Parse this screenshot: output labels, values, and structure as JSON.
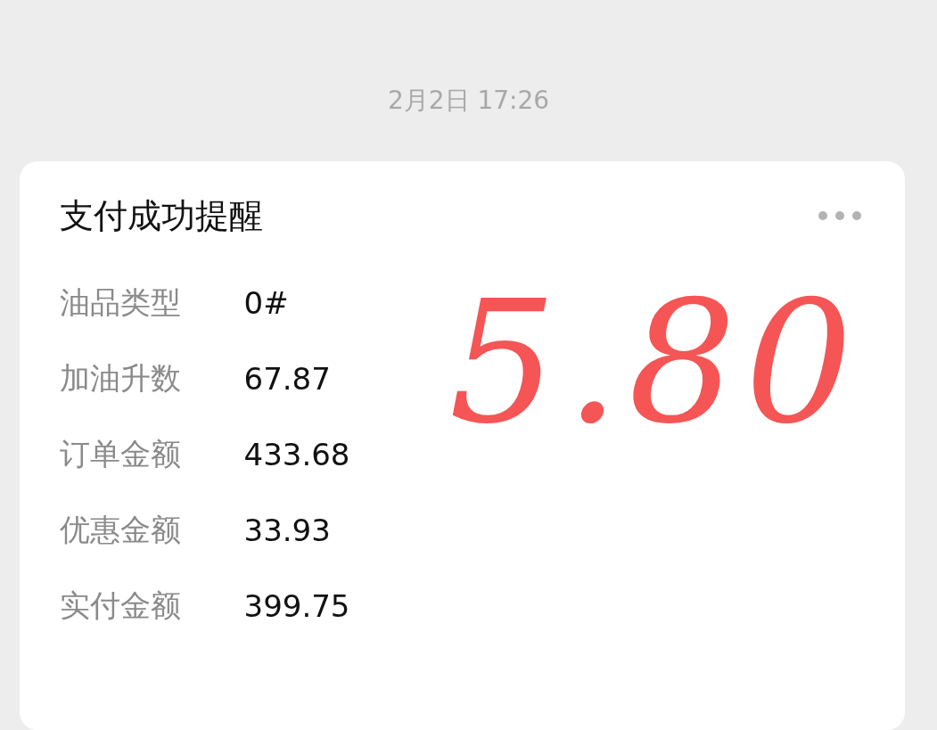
{
  "timestamp": "2月2日 17:26",
  "card": {
    "title": "支付成功提醒",
    "rows": [
      {
        "label": "油品类型",
        "value": "0#"
      },
      {
        "label": "加油升数",
        "value": "67.87"
      },
      {
        "label": "订单金额",
        "value": "433.68"
      },
      {
        "label": "优惠金额",
        "value": "33.93"
      },
      {
        "label": "实付金额",
        "value": "399.75"
      }
    ],
    "annotation": "5.80"
  }
}
